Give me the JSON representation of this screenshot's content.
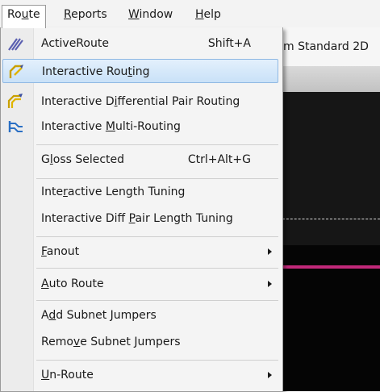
{
  "menubar": {
    "items": [
      {
        "pre": "Ro",
        "mn": "u",
        "post": "te"
      },
      {
        "pre": "",
        "mn": "R",
        "post": "eports"
      },
      {
        "pre": "",
        "mn": "W",
        "post": "indow"
      },
      {
        "pre": "",
        "mn": "H",
        "post": "elp"
      }
    ]
  },
  "background": {
    "toolbar_text": "m Standard 2D"
  },
  "menu": {
    "items": [
      {
        "pre": "ActiveRoute",
        "mn": "",
        "post": "",
        "shortcut": "Shift+A",
        "icon": "active-route-icon"
      },
      {
        "pre": "Interactive Rou",
        "mn": "t",
        "post": "ing",
        "shortcut": "",
        "icon": "interactive-routing-icon"
      },
      {
        "pre": "Interactive D",
        "mn": "i",
        "post": "fferential Pair Routing",
        "shortcut": "",
        "icon": "diff-pair-routing-icon"
      },
      {
        "pre": "Interactive ",
        "mn": "M",
        "post": "ulti-Routing",
        "shortcut": "",
        "icon": "multi-routing-icon"
      },
      {
        "pre": "G",
        "mn": "l",
        "post": "oss Selected",
        "shortcut": "Ctrl+Alt+G",
        "icon": ""
      },
      {
        "pre": "Inte",
        "mn": "r",
        "post": "active Length Tuning",
        "shortcut": "",
        "icon": ""
      },
      {
        "pre": "Interactive Diff ",
        "mn": "P",
        "post": "air Length Tuning",
        "shortcut": "",
        "icon": ""
      },
      {
        "pre": "",
        "mn": "F",
        "post": "anout",
        "shortcut": "",
        "icon": ""
      },
      {
        "pre": "",
        "mn": "A",
        "post": "uto Route",
        "shortcut": "",
        "icon": ""
      },
      {
        "pre": "A",
        "mn": "d",
        "post": "d Subnet Jumpers",
        "shortcut": "",
        "icon": ""
      },
      {
        "pre": "Remo",
        "mn": "v",
        "post": "e Subnet Jumpers",
        "shortcut": "",
        "icon": ""
      },
      {
        "pre": "",
        "mn": "U",
        "post": "n-Route",
        "shortcut": "",
        "icon": ""
      }
    ]
  },
  "colors": {
    "highlight": "#c9e1f8",
    "magenta": "#c2297a"
  }
}
